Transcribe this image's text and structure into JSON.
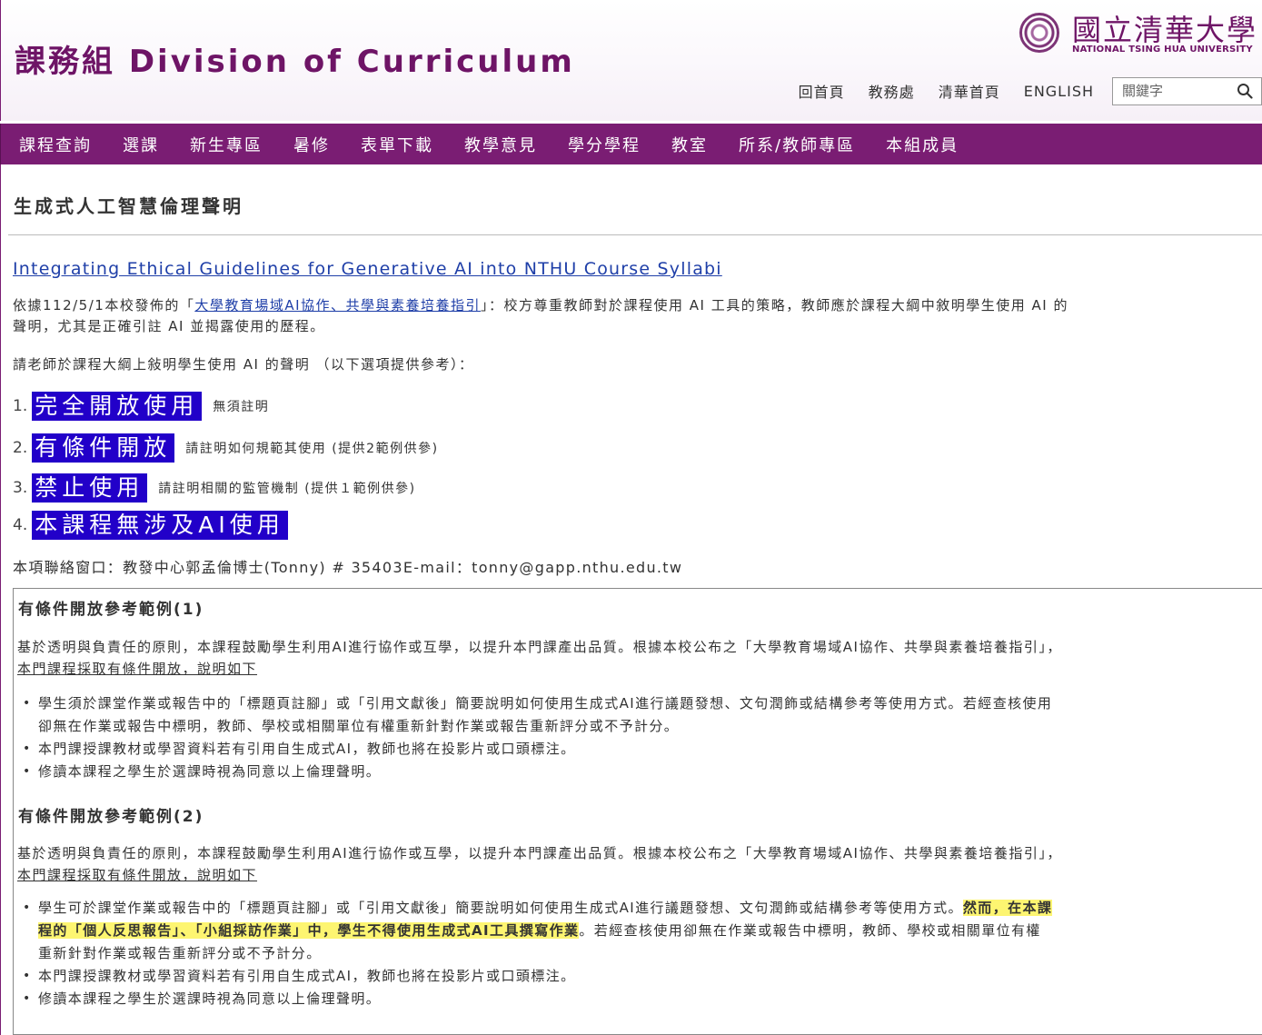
{
  "header": {
    "site_title": "課務組 Division of Curriculum",
    "logo_cn": "國立清華大學",
    "logo_en": "NATIONAL TSING HUA UNIVERSITY",
    "top_links": [
      "回首頁",
      "教務處",
      "清華首頁",
      "ENGLISH"
    ],
    "search_placeholder": "關鍵字"
  },
  "nav": {
    "items": [
      "課程查詢",
      "選課",
      "新生專區",
      "暑修",
      "表單下載",
      "教學意見",
      "學分學程",
      "教室",
      "所系/教師專區",
      "本組成員"
    ]
  },
  "main": {
    "page_title": "生成式人工智慧倫理聲明",
    "en_link": "Integrating Ethical Guidelines for Generative AI into NTHU Course Syllabi",
    "intro_prefix": "依據112/5/1本校發佈的「",
    "intro_link": "大學教育場域AI協作、共學與素養培養指引",
    "intro_suffix": "」：校方尊重教師對於課程使用 AI 工具的策略，教師應於課程大綱中敘明學生使用 AI 的",
    "intro_line2": "聲明，尤其是正確引註 AI 並揭露使用的歷程。",
    "request": "請老師於課程大綱上敍明學生使用 AI 的聲明 （以下選項提供參考）：",
    "options": [
      {
        "num": "1.",
        "label": "完全開放使用",
        "note": "無須註明"
      },
      {
        "num": "2.",
        "label": "有條件開放",
        "note": "請註明如何規範其使用 (提供2範例供參)"
      },
      {
        "num": "3.",
        "label": "禁止使用",
        "note": "請註明相關的監管機制 (提供１範例供參)"
      },
      {
        "num": "4.",
        "label": "本課程無涉及AI使用",
        "note": ""
      }
    ],
    "contact": "本項聯絡窗口：教發中心郭孟倫博士(Tonny) # 35403E-mail：tonny@gapp.nthu.edu.tw",
    "highlight_color": "#fdf571",
    "accent_color": "#7a1d73",
    "option_color": "#2200c9"
  },
  "examples": [
    {
      "heading": "有條件開放參考範例(1)",
      "intro": "基於透明與負責任的原則，本課程鼓勵學生利用AI進行協作或互學，以提升本門課產出品質。根據本校公布之「大學教育場域AI協作、共學與素養培養指引」，",
      "intro_underlined": "本門課程採取有條件開放，說明如下",
      "bullets": [
        "學生須於課堂作業或報告中的「標題頁註腳」或「引用文獻後」簡要說明如何使用生成式AI進行議題發想、文句潤飾或結構參考等使用方式。若經查核使用",
        "卻無在作業或報告中標明，教師、學校或相關單位有權重新針對作業或報告重新評分或不予計分。",
        "本門課授課教材或學習資料若有引用自生成式AI，教師也將在投影片或口頭標注。",
        "修讀本課程之學生於選課時視為同意以上倫理聲明。"
      ]
    },
    {
      "heading": "有條件開放參考範例(2)",
      "intro": "基於透明與負責任的原則，本課程鼓勵學生利用AI進行協作或互學，以提升本門課產出品質。根據本校公布之「大學教育場域AI協作、共學與素養培養指引」，",
      "intro_underlined": "本門課程採取有條件開放，說明如下",
      "bullet1_part1": "學生可於課堂作業或報告中的「標題頁註腳」或「引用文獻後」簡要說明如何使用生成式AI進行議題發想、文句潤飾或結構參考等使用方式。",
      "bullet1_hl1": "然而，在本課",
      "bullet1_hl2": "程的「個人反思報告」、「小組採訪作業」中，學生不得使用生成式AI工具撰寫作業",
      "bullet1_part2": "。若經查核使用卻無在作業或報告中標明，教師、學校或相關單位有權",
      "bullet1_part3": "重新針對作業或報告重新評分或不予計分。",
      "bullets_rest": [
        "本門課授課教材或學習資料若有引用自生成式AI，教師也將在投影片或口頭標注。",
        "修讀本課程之學生於選課時視為同意以上倫理聲明。"
      ]
    }
  ]
}
